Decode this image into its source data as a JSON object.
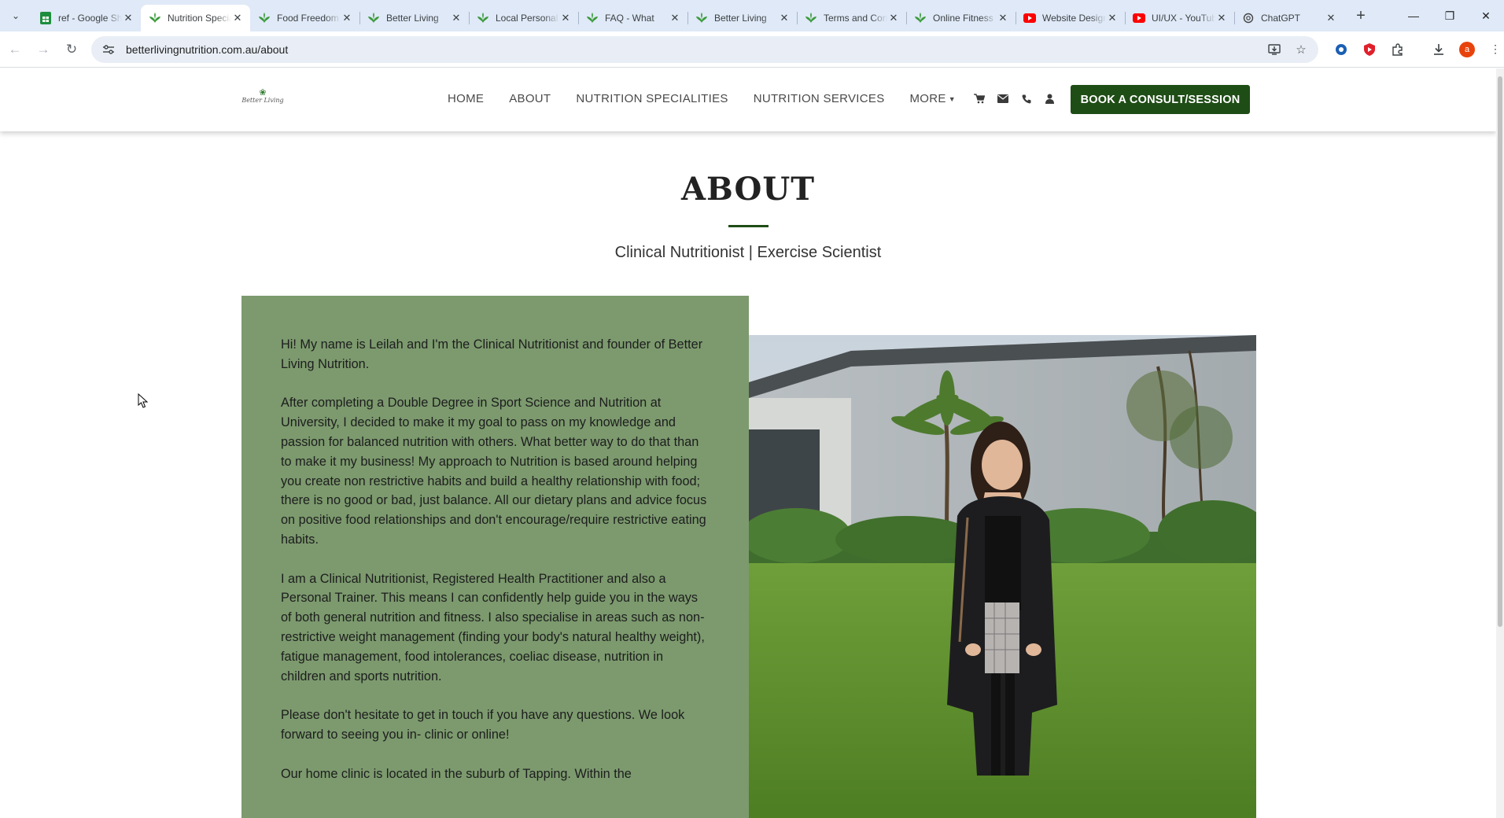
{
  "browser": {
    "tabs": [
      {
        "title": "ref - Google Sheets",
        "icon": "sheets-icon",
        "active": false
      },
      {
        "title": "Nutrition Specialities",
        "icon": "leaf-icon",
        "active": true
      },
      {
        "title": "Food Freedom",
        "icon": "leaf-icon",
        "active": false
      },
      {
        "title": "Better Living",
        "icon": "leaf-icon",
        "active": false
      },
      {
        "title": "Local Personal",
        "icon": "leaf-icon",
        "active": false
      },
      {
        "title": "FAQ - What",
        "icon": "leaf-icon",
        "active": false
      },
      {
        "title": "Better Living",
        "icon": "leaf-icon",
        "active": false
      },
      {
        "title": "Terms and Conditions",
        "icon": "leaf-icon",
        "active": false
      },
      {
        "title": "Online Fitness",
        "icon": "leaf-icon",
        "active": false
      },
      {
        "title": "Website Design",
        "icon": "youtube-icon",
        "active": false
      },
      {
        "title": "UI/UX - YouTube",
        "icon": "youtube-icon",
        "active": false
      },
      {
        "title": "ChatGPT",
        "icon": "chatgpt-icon",
        "active": false
      }
    ],
    "url": "betterlivingnutrition.com.au/about",
    "profile_initial": "a"
  },
  "site": {
    "logo_text": "Better Living",
    "nav": {
      "home": "HOME",
      "about": "ABOUT",
      "specialities": "NUTRITION SPECIALITIES",
      "services": "NUTRITION SERVICES",
      "more": "MORE"
    },
    "book_button": "BOOK A CONSULT/SESSION",
    "page_title": "ABOUT",
    "subtitle": "Clinical Nutritionist | Exercise Scientist",
    "bio": [
      "Hi! My name is Leilah and I'm the Clinical Nutritionist and founder of Better Living Nutrition.",
      "After completing a Double Degree in Sport Science and Nutrition at University, I decided to make it my goal to pass on my knowledge and passion for balanced nutrition with others. What better way to do that than to make it my business! My approach to Nutrition is based around helping you create non restrictive habits and build a healthy relationship with food; there is no good or bad, just balance. All our dietary plans and advice focus on positive food relationships and don't encourage/require restrictive eating habits.",
      "I am a Clinical Nutritionist, Registered Health Practitioner and also a Personal Trainer. This means I can confidently help guide you in the ways of both general nutrition and fitness. I also specialise in areas such as non-restrictive weight management (finding your body's natural healthy weight), fatigue management, food intolerances, coeliac disease, nutrition in children and sports nutrition.",
      "Please don't hesitate to get in touch if you have any questions. We look forward to seeing you in- clinic or online!",
      "Our home clinic is located in the suburb of Tapping. Within the"
    ]
  },
  "colors": {
    "brand_green": "#1f4d16",
    "panel_green": "#7c9a6e",
    "tabstrip": "#dfe9f7"
  }
}
